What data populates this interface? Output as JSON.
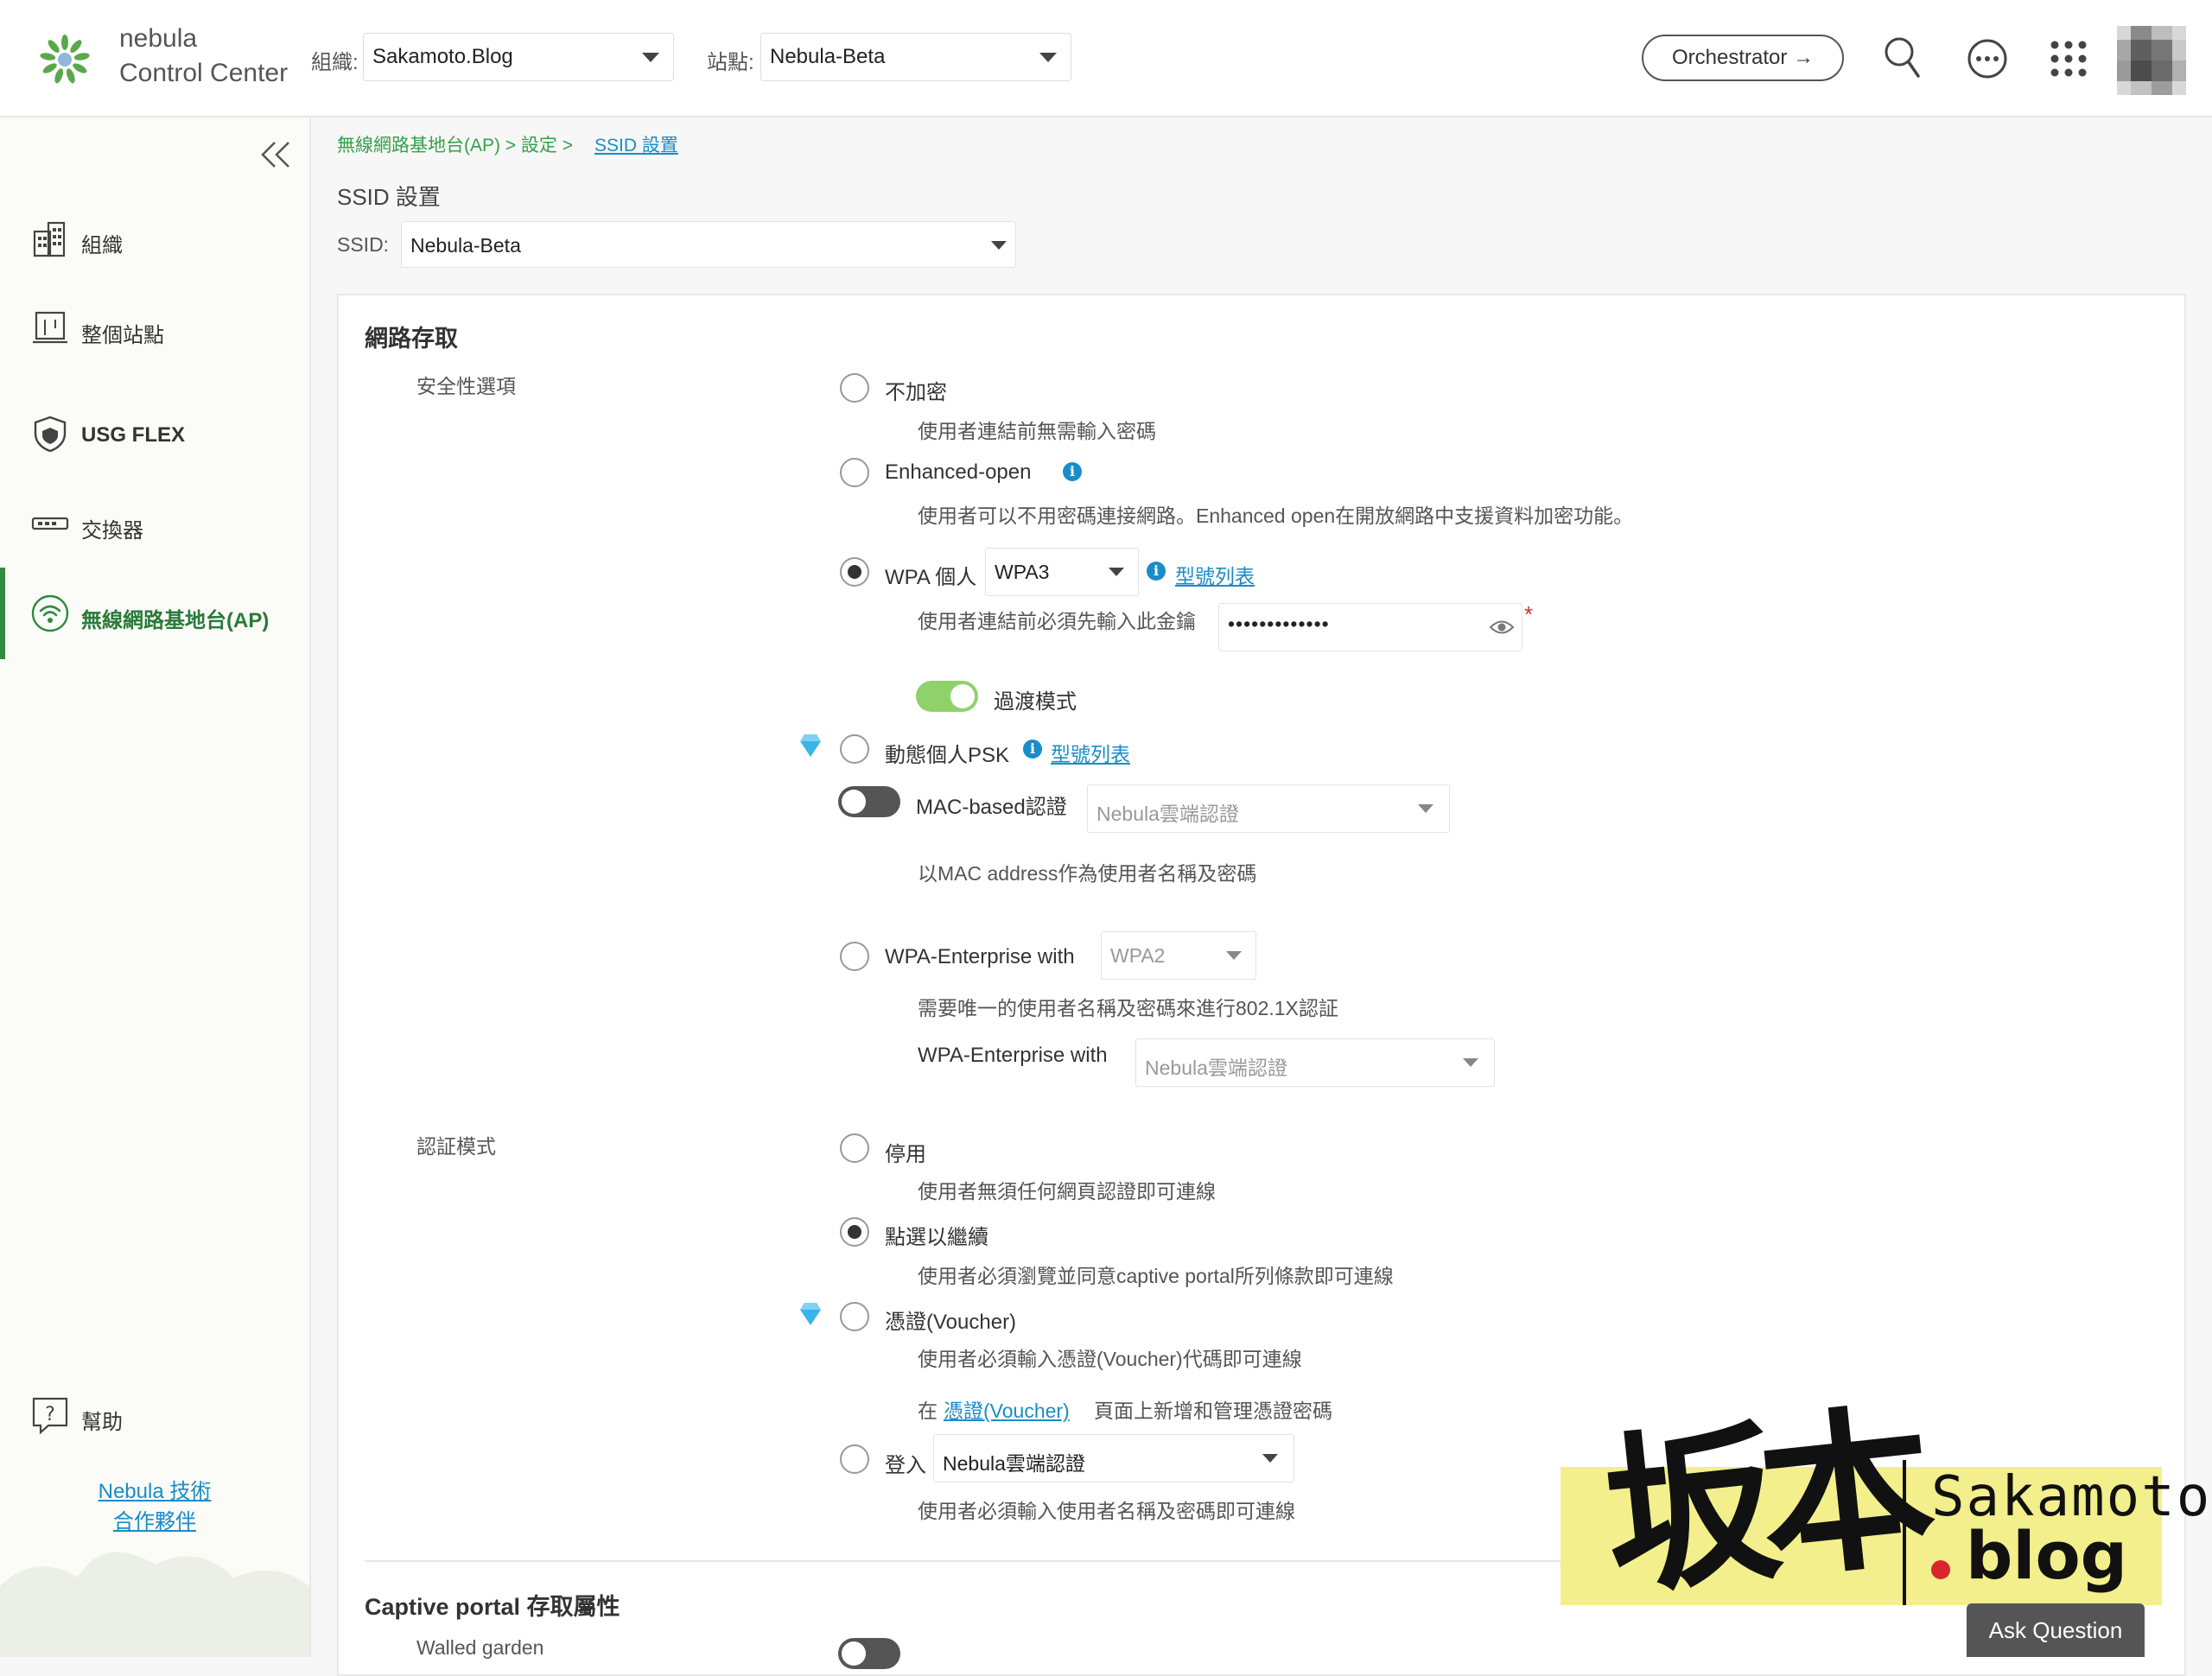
{
  "header": {
    "brand_line1": "nebula",
    "brand_line2": "Control Center",
    "org_label": "組織:",
    "org_value": "Sakamoto.Blog",
    "site_label": "站點:",
    "site_value": "Nebula-Beta",
    "orchestrator_label": "Orchestrator →"
  },
  "sidebar": {
    "items": [
      {
        "label": "組織",
        "icon": "building-icon"
      },
      {
        "label": "整個站點",
        "icon": "site-icon"
      },
      {
        "label": "USG FLEX",
        "icon": "shield-icon"
      },
      {
        "label": "交換器",
        "icon": "switch-icon"
      },
      {
        "label": "無線網路基地台(AP)",
        "icon": "wifi-icon"
      }
    ],
    "help_label": "幫助",
    "partner_line1": "Nebula 技術",
    "partner_line2": "合作夥伴"
  },
  "breadcrumb": {
    "part1": "無線網路基地台(AP) > 設定 >",
    "current": "SSID 設置"
  },
  "page": {
    "title": "SSID 設置",
    "ssid_label": "SSID:",
    "ssid_value": "Nebula-Beta"
  },
  "network_access": {
    "title": "網路存取",
    "security_label": "安全性選項",
    "no_encryption": "不加密",
    "no_encryption_desc": "使用者連結前無需輸入密碼",
    "enhanced_open": "Enhanced-open",
    "enhanced_open_desc": "使用者可以不用密碼連接網路。Enhanced open在開放網路中支援資料加密功能。",
    "wpa_personal": "WPA 個人",
    "wpa_version": "WPA3",
    "model_list": "型號列表",
    "key_desc": "使用者連結前必須先輸入此金鑰",
    "key_value": "•••••••••••••",
    "required_mark": "*",
    "transition_mode": "過渡模式",
    "dynamic_psk": "動態個人PSK",
    "model_list2": "型號列表",
    "mac_auth": "MAC-based認證",
    "mac_auth_select": "Nebula雲端認證",
    "mac_desc": "以MAC address作為使用者名稱及密碼",
    "wpa_enterprise": "WPA-Enterprise with",
    "wpa_enterprise_version": "WPA2",
    "wpa_enterprise_desc": "需要唯一的使用者名稱及密碼來進行802.1X認証",
    "wpa_enterprise_with": "WPA-Enterprise with",
    "wpa_enterprise_auth": "Nebula雲端認證"
  },
  "auth_mode": {
    "label": "認証模式",
    "disabled": "停用",
    "disabled_desc": "使用者無須任何網頁認證即可連線",
    "click_through": "點選以繼續",
    "click_through_desc": "使用者必須瀏覽並同意captive portal所列條款即可連線",
    "voucher": "憑證(Voucher)",
    "voucher_desc": "使用者必須輸入憑證(Voucher)代碼即可連線",
    "voucher_manage_pre": "在",
    "voucher_manage_link": "憑證(Voucher)",
    "voucher_manage_post": "頁面上新增和管理憑證密碼",
    "signon": "登入",
    "signon_select": "Nebula雲端認證",
    "signon_desc": "使用者必須輸入使用者名稱及密碼即可連線"
  },
  "captive": {
    "title": "Captive portal 存取屬性",
    "walled_garden": "Walled garden"
  },
  "watermark": {
    "cn": "坂本",
    "line1": "Sakamoto",
    "line2": "blog"
  },
  "ask_question": "Ask Question",
  "colors": {
    "accent_green": "#35a04a",
    "link_blue": "#1a8cc7",
    "toggle_on": "#8fd16b"
  }
}
